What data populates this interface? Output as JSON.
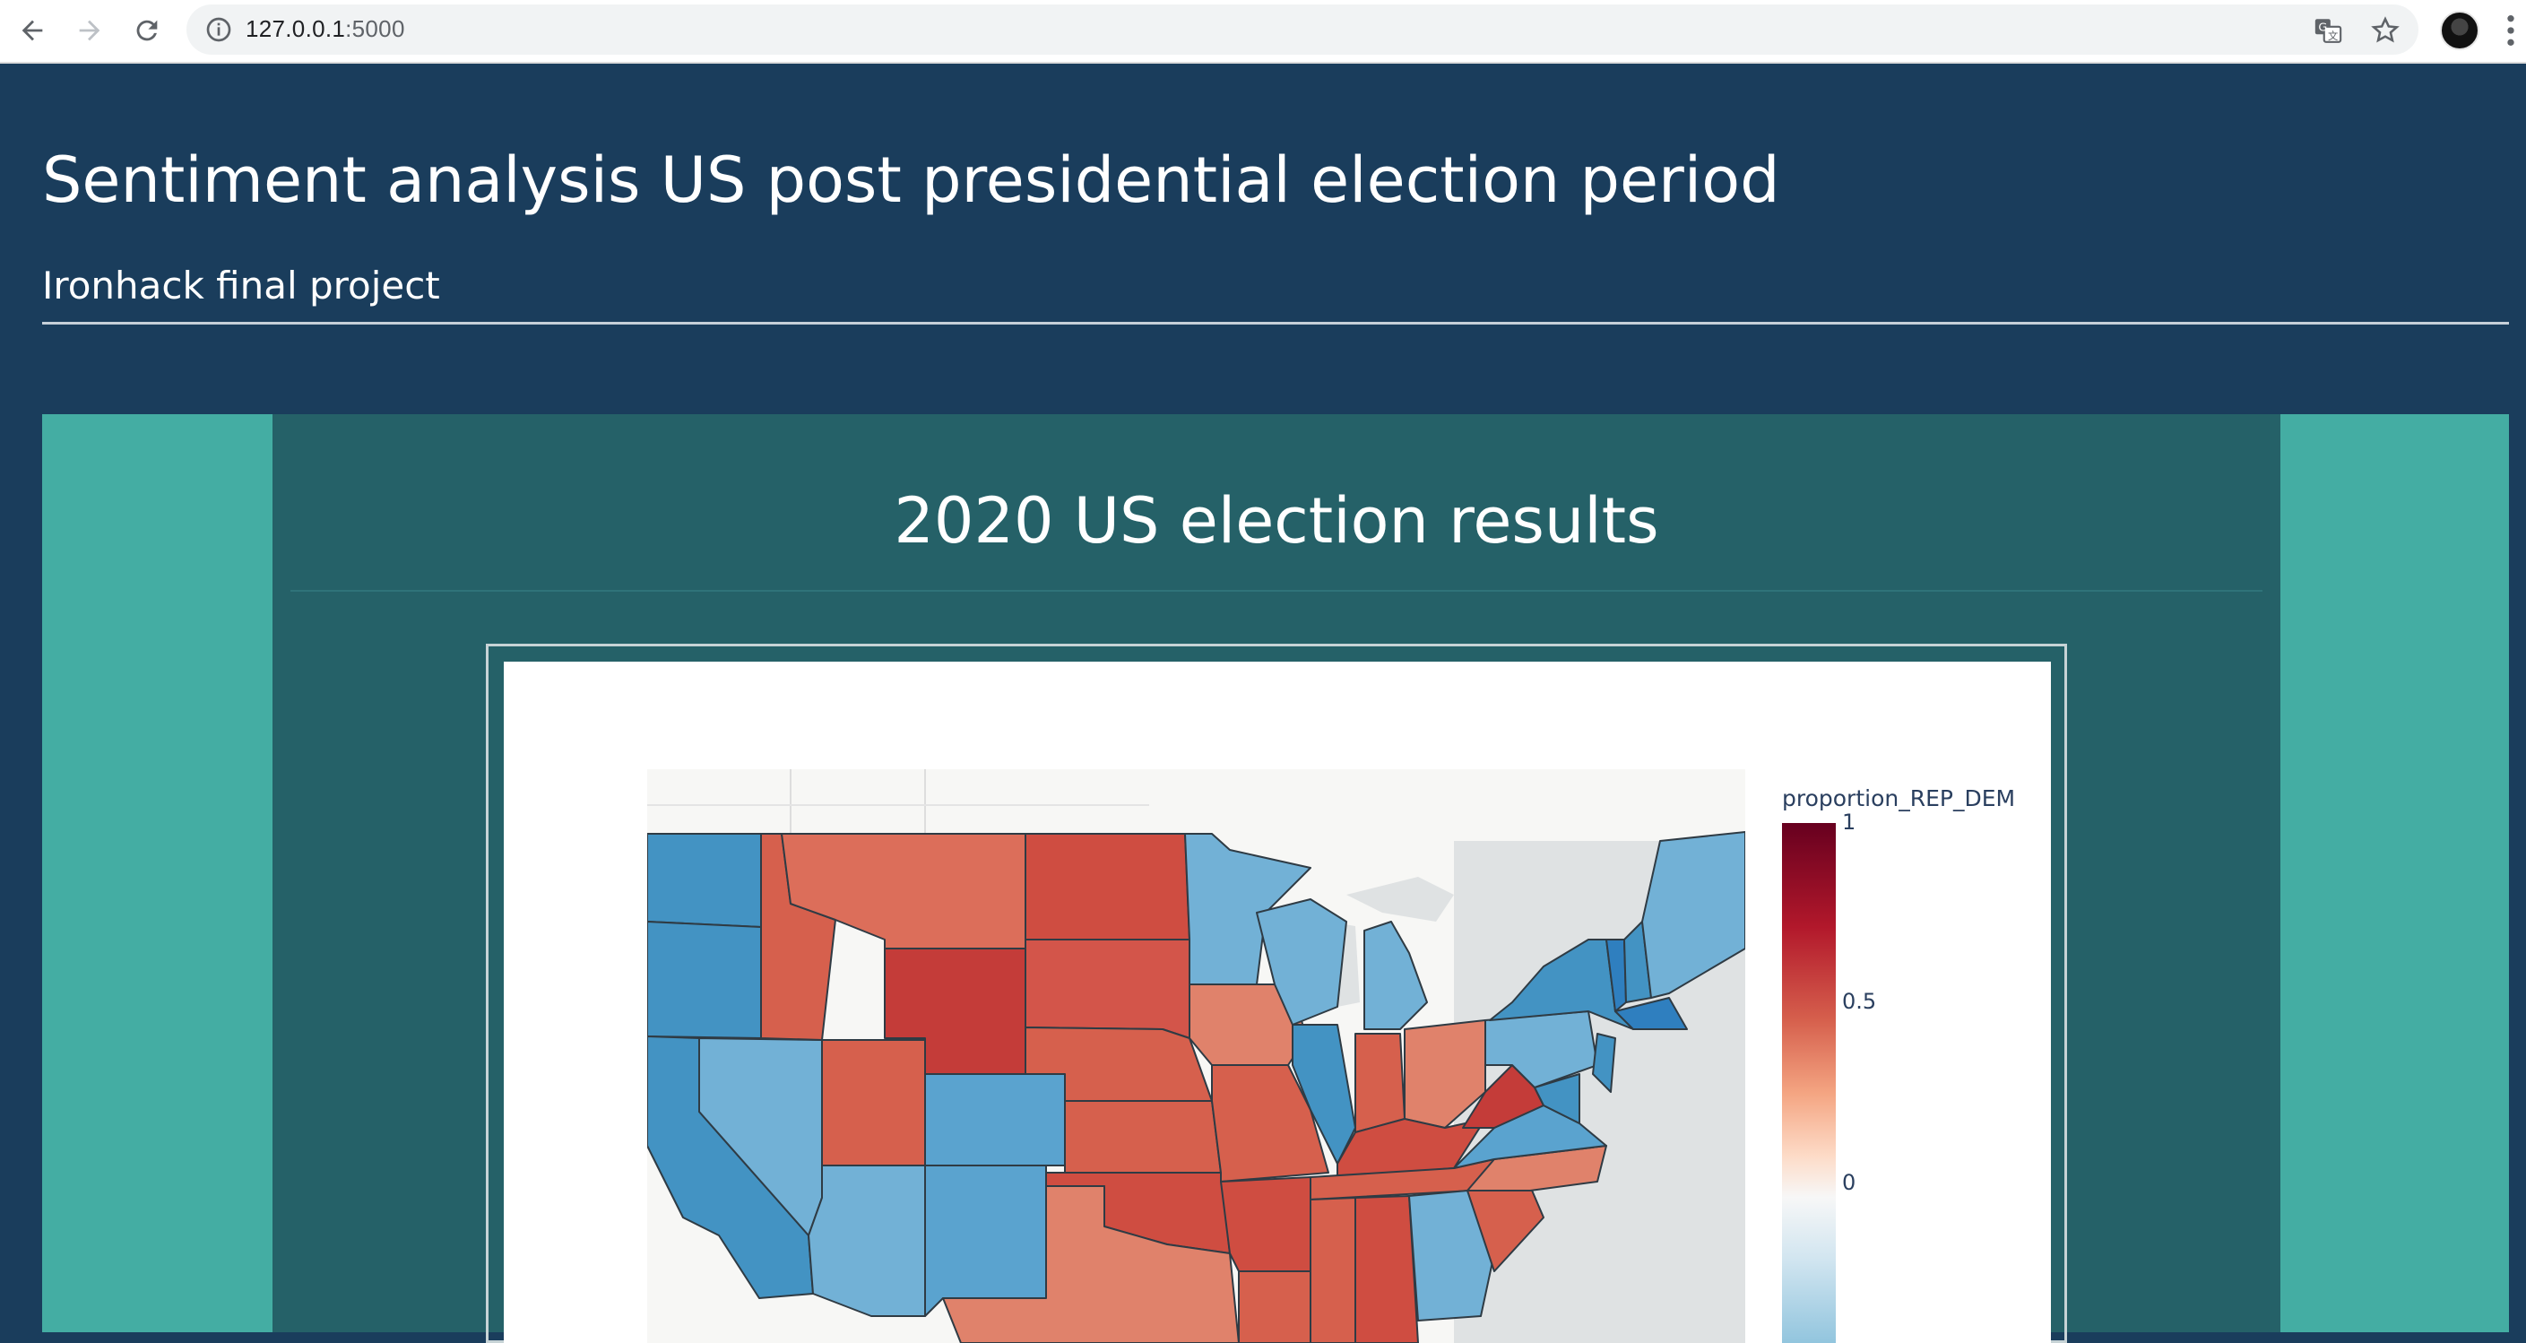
{
  "browser": {
    "url_host": "127.0.0.1",
    "url_port": ":5000",
    "icons": [
      "back-arrow-icon",
      "forward-arrow-icon",
      "reload-icon",
      "info-icon",
      "translate-icon",
      "star-icon",
      "profile-avatar",
      "more-menu-icon"
    ]
  },
  "header": {
    "title": "Sentiment analysis US post presidential election period",
    "subtitle": "Ironhack final project"
  },
  "section": {
    "title": "2020 US election results"
  },
  "colorbar": {
    "title": "proportion_REP_DEM",
    "ticks": [
      "1",
      "0.5",
      "0"
    ]
  },
  "colors": {
    "page_bg": "#1a3d5c",
    "side_panel": "#44ada3",
    "center_panel": "#256168",
    "rep": "#d6604d",
    "dem": "#4393c3"
  },
  "chart_data": {
    "type": "choropleth",
    "colorscale_min": 0,
    "colorscale_max": 1,
    "colorbar_title": "proportion_REP_DEM",
    "states": [
      {
        "state": "WA",
        "party": "DEM"
      },
      {
        "state": "OR",
        "party": "DEM"
      },
      {
        "state": "CA",
        "party": "DEM"
      },
      {
        "state": "NV",
        "party": "DEM"
      },
      {
        "state": "ID",
        "party": "REP"
      },
      {
        "state": "MT",
        "party": "REP"
      },
      {
        "state": "WY",
        "party": "REP"
      },
      {
        "state": "UT",
        "party": "REP"
      },
      {
        "state": "AZ",
        "party": "DEM"
      },
      {
        "state": "CO",
        "party": "DEM"
      },
      {
        "state": "NM",
        "party": "DEM"
      },
      {
        "state": "ND",
        "party": "REP"
      },
      {
        "state": "SD",
        "party": "REP"
      },
      {
        "state": "NE",
        "party": "REP"
      },
      {
        "state": "KS",
        "party": "REP"
      },
      {
        "state": "OK",
        "party": "REP"
      },
      {
        "state": "TX",
        "party": "REP"
      },
      {
        "state": "MN",
        "party": "DEM"
      },
      {
        "state": "IA",
        "party": "REP"
      },
      {
        "state": "MO",
        "party": "REP"
      },
      {
        "state": "AR",
        "party": "REP"
      },
      {
        "state": "LA",
        "party": "REP"
      },
      {
        "state": "WI",
        "party": "DEM"
      },
      {
        "state": "IL",
        "party": "DEM"
      },
      {
        "state": "MI",
        "party": "DEM"
      },
      {
        "state": "IN",
        "party": "REP"
      },
      {
        "state": "OH",
        "party": "REP"
      },
      {
        "state": "KY",
        "party": "REP"
      },
      {
        "state": "TN",
        "party": "REP"
      },
      {
        "state": "MS",
        "party": "REP"
      },
      {
        "state": "AL",
        "party": "REP"
      },
      {
        "state": "GA",
        "party": "DEM"
      },
      {
        "state": "SC",
        "party": "REP"
      },
      {
        "state": "NC",
        "party": "REP"
      },
      {
        "state": "VA",
        "party": "DEM"
      },
      {
        "state": "WV",
        "party": "REP"
      },
      {
        "state": "PA",
        "party": "DEM"
      },
      {
        "state": "NY",
        "party": "DEM"
      },
      {
        "state": "NJ",
        "party": "DEM"
      },
      {
        "state": "VT",
        "party": "DEM"
      },
      {
        "state": "NH",
        "party": "DEM"
      },
      {
        "state": "ME",
        "party": "DEM"
      },
      {
        "state": "MA",
        "party": "DEM"
      },
      {
        "state": "MD",
        "party": "DEM"
      }
    ]
  }
}
